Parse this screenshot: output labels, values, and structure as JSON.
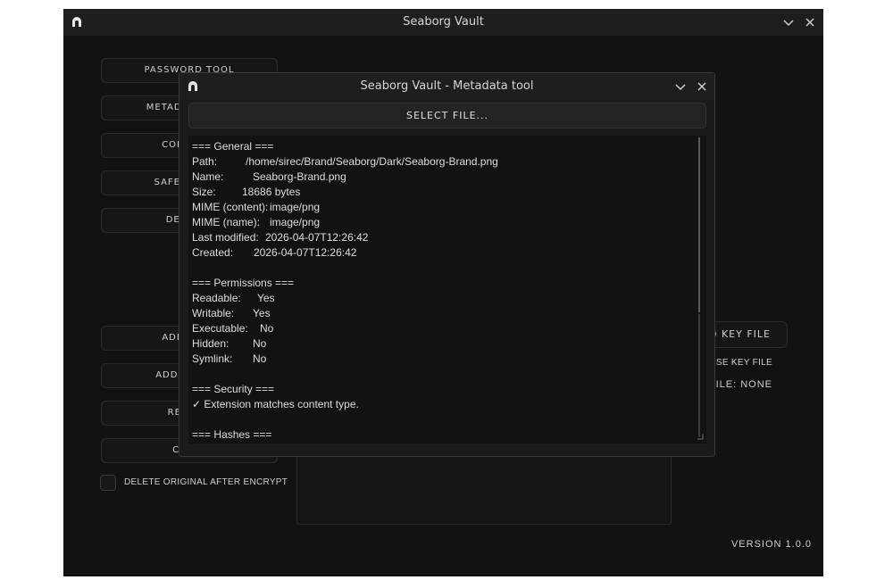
{
  "main": {
    "title": "Seaborg Vault",
    "sidebar": [
      {
        "label": "PASSWORD TOOL"
      },
      {
        "label": "METADATA TOOL"
      },
      {
        "label": "CONTACTS"
      },
      {
        "label": "SAFE VIEWER"
      },
      {
        "label": "DECRYPT"
      }
    ],
    "actions": [
      {
        "label": "ADD FILES"
      },
      {
        "label": "ADD FOLDER"
      },
      {
        "label": "REMOVE"
      },
      {
        "label": "CLEAR"
      }
    ],
    "delete_original_label": "DELETE ORIGINAL AFTER ENCRYPT",
    "key_file_button": "ADD KEY FILE",
    "use_key_file_label": "USE KEY FILE",
    "key_file_status": "KEY FILE: NONE",
    "version": "VERSION 1.0.0"
  },
  "dialog": {
    "title": "Seaborg Vault - Metadata tool",
    "select_file_label": "SELECT FILE...",
    "general_header": "=== General ===",
    "general": [
      {
        "label": "Path:",
        "value": "/home/sirec/Brand/Seaborg/Dark/Seaborg-Brand.png"
      },
      {
        "label": "Name:",
        "value": "Seaborg-Brand.png"
      },
      {
        "label": "Size:",
        "value": "18686 bytes"
      },
      {
        "label": "MIME (content):",
        "value": "image/png"
      },
      {
        "label": "MIME (name):",
        "value": "image/png"
      },
      {
        "label": "Last modified:",
        "value": "2026-04-07T12:26:42"
      },
      {
        "label": "Created:",
        "value": "2026-04-07T12:26:42"
      }
    ],
    "permissions_header": "=== Permissions ===",
    "permissions": [
      {
        "label": "Readable:",
        "value": "Yes"
      },
      {
        "label": "Writable:",
        "value": "Yes"
      },
      {
        "label": "Executable:",
        "value": "No"
      },
      {
        "label": "Hidden:",
        "value": "No"
      },
      {
        "label": "Symlink:",
        "value": "No"
      }
    ],
    "security_header": "=== Security ===",
    "security_line": "✓ Extension matches content type.",
    "hashes_header": "=== Hashes ==="
  }
}
